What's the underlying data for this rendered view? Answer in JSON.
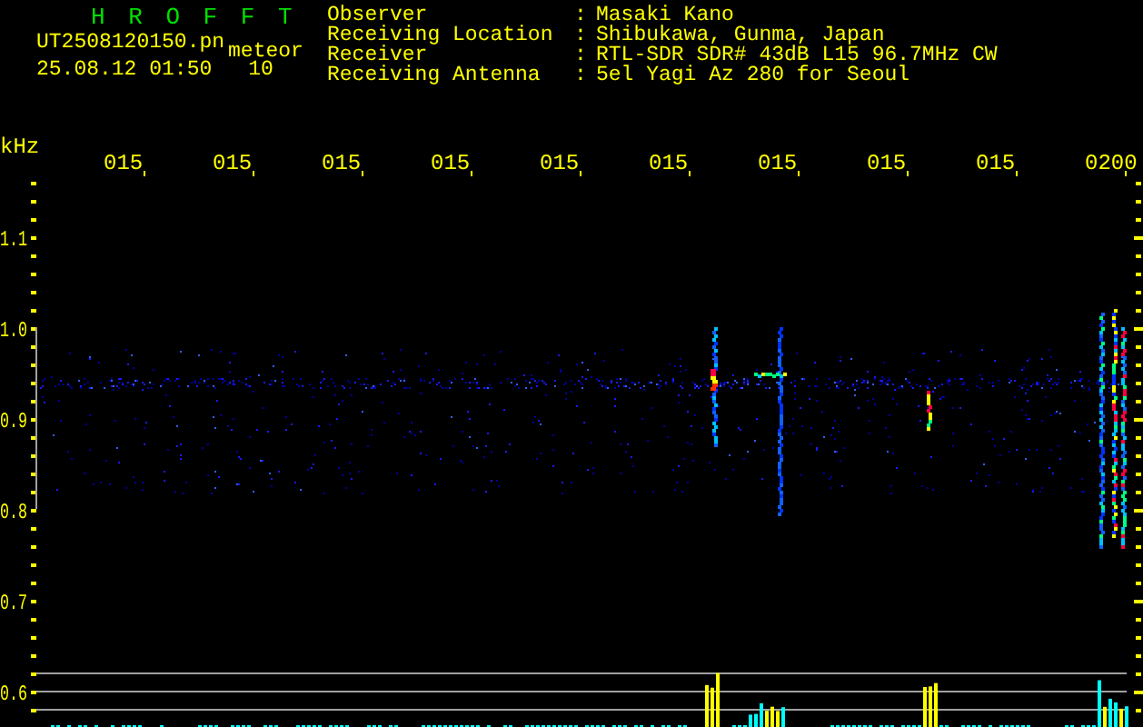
{
  "title": "H R O F F T",
  "file_name": "UT2508120150.pn",
  "category": "meteor",
  "timestamp": "25.08.12 01:50",
  "count": "10",
  "info": [
    {
      "label": "Observer",
      "colon": ":",
      "value": "Masaki Kano"
    },
    {
      "label": "Receiving Location",
      "colon": ":",
      "value": "Shibukawa, Gunma, Japan"
    },
    {
      "label": "Receiver",
      "colon": ":",
      "value": "RTL-SDR SDR# 43dB L15 96.7MHz CW"
    },
    {
      "label": "Receiving Antenna",
      "colon": ":",
      "value": "5el Yagi Az 280 for Seoul"
    }
  ],
  "x_axis": {
    "labels": [
      "015",
      "015",
      "015",
      "015",
      "015",
      "015",
      "015",
      "015",
      "015",
      "0200"
    ]
  },
  "y_axis": {
    "unit": "kHz",
    "labels": [
      "1.1",
      "1.0",
      "0.9",
      "0.8",
      "0.7",
      "0.6"
    ]
  }
}
